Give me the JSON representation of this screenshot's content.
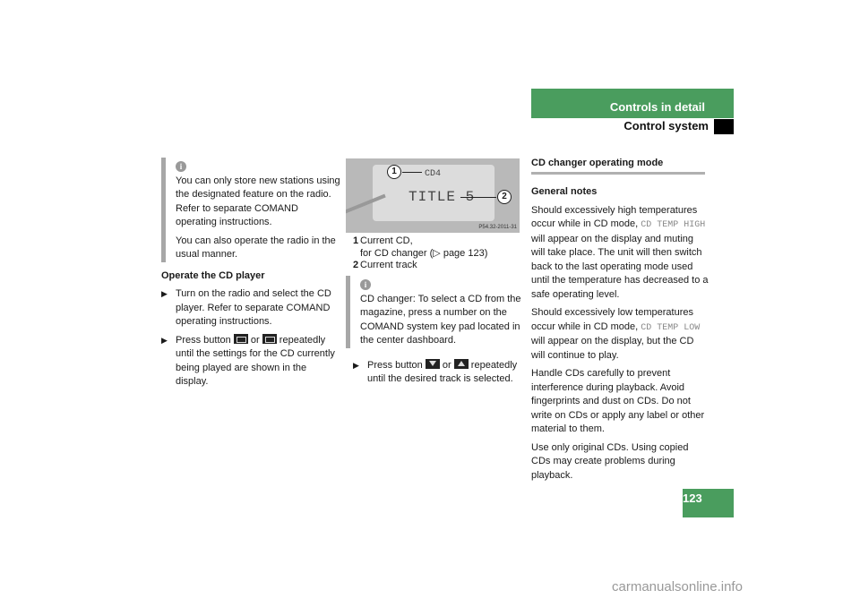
{
  "header": {
    "section": "Controls in detail",
    "subsection": "Control system"
  },
  "left_column": {
    "info_box": {
      "icon": "info-icon",
      "paragraphs": [
        "You can only store new stations using the designated feature on the radio. Refer to separate COMAND operating instructions.",
        "You can also operate the radio in the usual manner."
      ]
    },
    "heading": "Operate the CD player",
    "steps": [
      {
        "text": "Turn on the radio and select the CD player. Refer to separate COMAND operating instructions."
      },
      {
        "before": "Press button",
        "mid": "or",
        "after": "repeatedly until the settings for the CD currently being played are shown in the display.",
        "button_icons": [
          "display-button-icon",
          "display-button-icon"
        ]
      }
    ]
  },
  "middle_column": {
    "figure": {
      "lcd_line1": "CD4",
      "lcd_line2": "TITLE 5",
      "callouts": [
        "1",
        "2"
      ],
      "figure_code": "P54.32-2011-31"
    },
    "legend": [
      {
        "num": "1",
        "line1": "Current CD,",
        "line2": "for CD changer (▷ page 123)"
      },
      {
        "num": "2",
        "line1": "Current track"
      }
    ],
    "info_box": {
      "icon": "info-icon",
      "text": "CD changer: To select a CD from the magazine, press a number on the COMAND system key pad located in the center dashboard."
    },
    "step": {
      "before": "Press button",
      "mid": "or",
      "after": "repeatedly until the desired track is selected.",
      "button_icons": [
        "down-button-icon",
        "up-button-icon"
      ]
    }
  },
  "right_column": {
    "section_title": "CD changer operating mode",
    "subheading": "General notes",
    "p1": {
      "a": "Should excessively high temperatures occur while in CD mode,",
      "code": "CD TEMP HIGH",
      "b": "will appear on the display and muting will take place. The unit will then switch back to the last operating mode used until the temperature has decreased to a safe operating level."
    },
    "p2": {
      "a": "Should excessively low temperatures occur while in CD mode,",
      "code": "CD TEMP LOW",
      "b": "will appear on the display, but the CD will continue to play."
    },
    "p3": "Handle CDs carefully to prevent interference during playback. Avoid fingerprints and dust on CDs. Do not write on CDs or apply any label or other material to them.",
    "p4": "Use only original CDs. Using copied CDs may create problems during playback."
  },
  "page_number": "123",
  "watermark": "carmanualsonline.info",
  "colors": {
    "accent_green": "#4a9d5e"
  }
}
